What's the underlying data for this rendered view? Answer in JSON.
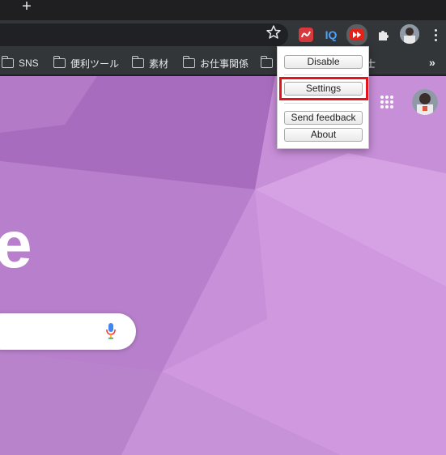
{
  "browser": {
    "new_tab_label": "+",
    "bookmarks": [
      {
        "label": "SNS"
      },
      {
        "label": "便利ツール"
      },
      {
        "label": "素材"
      },
      {
        "label": "お仕事関係"
      },
      {
        "label": ""
      },
      {
        "label": "士"
      }
    ],
    "overflow_label": "»"
  },
  "extensions": {
    "iq_label": "IQ"
  },
  "newtab_page": {
    "logo_fragment": "e"
  },
  "popup_menu": {
    "disable_label": "Disable",
    "settings_label": "Settings",
    "send_feedback_label": "Send feedback",
    "about_label": "About",
    "highlight_color": "#e3141b"
  },
  "colors": {
    "chrome_dark": "#323639",
    "background_purple": "#b57fca"
  }
}
